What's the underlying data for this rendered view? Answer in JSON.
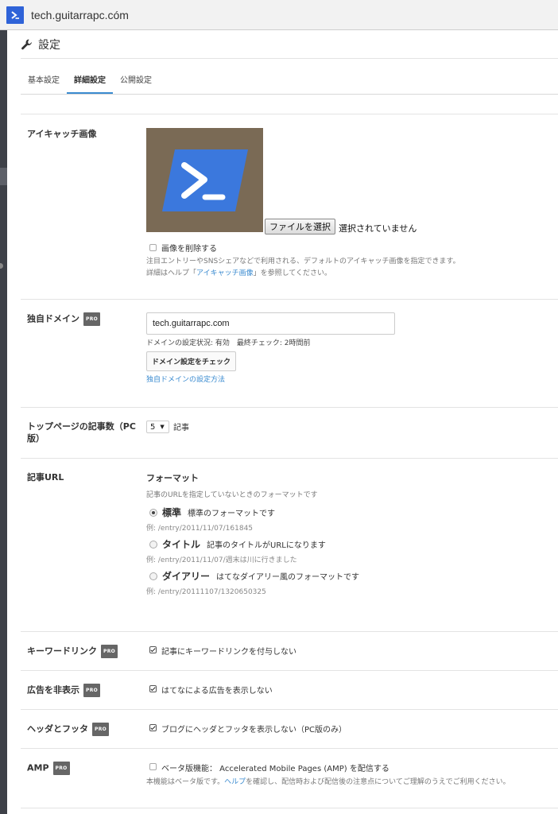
{
  "browser": {
    "title": "tech.guitarrapc.cóm"
  },
  "page": {
    "title": "設定"
  },
  "tabs": [
    {
      "label": "基本設定",
      "active": false
    },
    {
      "label": "詳細設定",
      "active": true
    },
    {
      "label": "公開設定",
      "active": false
    }
  ],
  "eyecatch": {
    "label": "アイキャッチ画像",
    "file_button": "ファイルを選択",
    "file_status": "選択されていません",
    "delete_label": "画像を削除する",
    "delete_checked": false,
    "help1": "注目エントリーやSNSシェアなどで利用される、デフォルトのアイキャッチ画像を指定できます。",
    "help2_prefix": "詳細はヘルプ「",
    "help2_link": "アイキャッチ画像",
    "help2_suffix": "」を参照してください。"
  },
  "domain": {
    "label": "独自ドメイン",
    "pro_badge": "PRO",
    "value": "tech.guitarrapc.com",
    "status": "ドメインの設定状況: 有効　最終チェック: 2時間前",
    "check_button": "ドメイン設定をチェック",
    "howto_link": "独自ドメインの設定方法"
  },
  "top_count": {
    "label": "トップページの記事数（PC版）",
    "value": "5",
    "unit": "記事"
  },
  "url": {
    "label": "記事URL",
    "heading": "フォーマット",
    "note": "記事のURLを指定していないときのフォーマットです",
    "options": [
      {
        "name": "標準",
        "desc": "標準のフォーマットです",
        "example": "例: /entry/2011/11/07/161845",
        "checked": true
      },
      {
        "name": "タイトル",
        "desc": "記事のタイトルがURLになります",
        "example": "例: /entry/2011/11/07/週末は川に行きました",
        "checked": false
      },
      {
        "name": "ダイアリー",
        "desc": "はてなダイアリー風のフォーマットです",
        "example": "例: /entry/20111107/1320650325",
        "checked": false
      }
    ]
  },
  "keyword": {
    "label": "キーワードリンク",
    "pro_badge": "PRO",
    "option": "記事にキーワードリンクを付与しない",
    "checked": true
  },
  "ads": {
    "label": "広告を非表示",
    "pro_badge": "PRO",
    "option": "はてなによる広告を表示しない",
    "checked": true
  },
  "header_footer": {
    "label": "ヘッダとフッタ",
    "pro_badge": "PRO",
    "option": "ブログにヘッダとフッタを表示しない（PC版のみ）",
    "checked": true
  },
  "amp": {
    "label": "AMP",
    "pro_badge": "PRO",
    "option": "ベータ版機能： Accelerated Mobile Pages (AMP) を配信する",
    "checked": false,
    "note_prefix": "本機能はベータ版です。",
    "note_link": "ヘルプ",
    "note_suffix": "を確認し、配信時および配信後の注意点についてご理解のうえでご利用ください。"
  },
  "colors": {
    "accent": "#3b8bd0",
    "logo": "#2f63d8",
    "sidebar": "#3e4148"
  }
}
